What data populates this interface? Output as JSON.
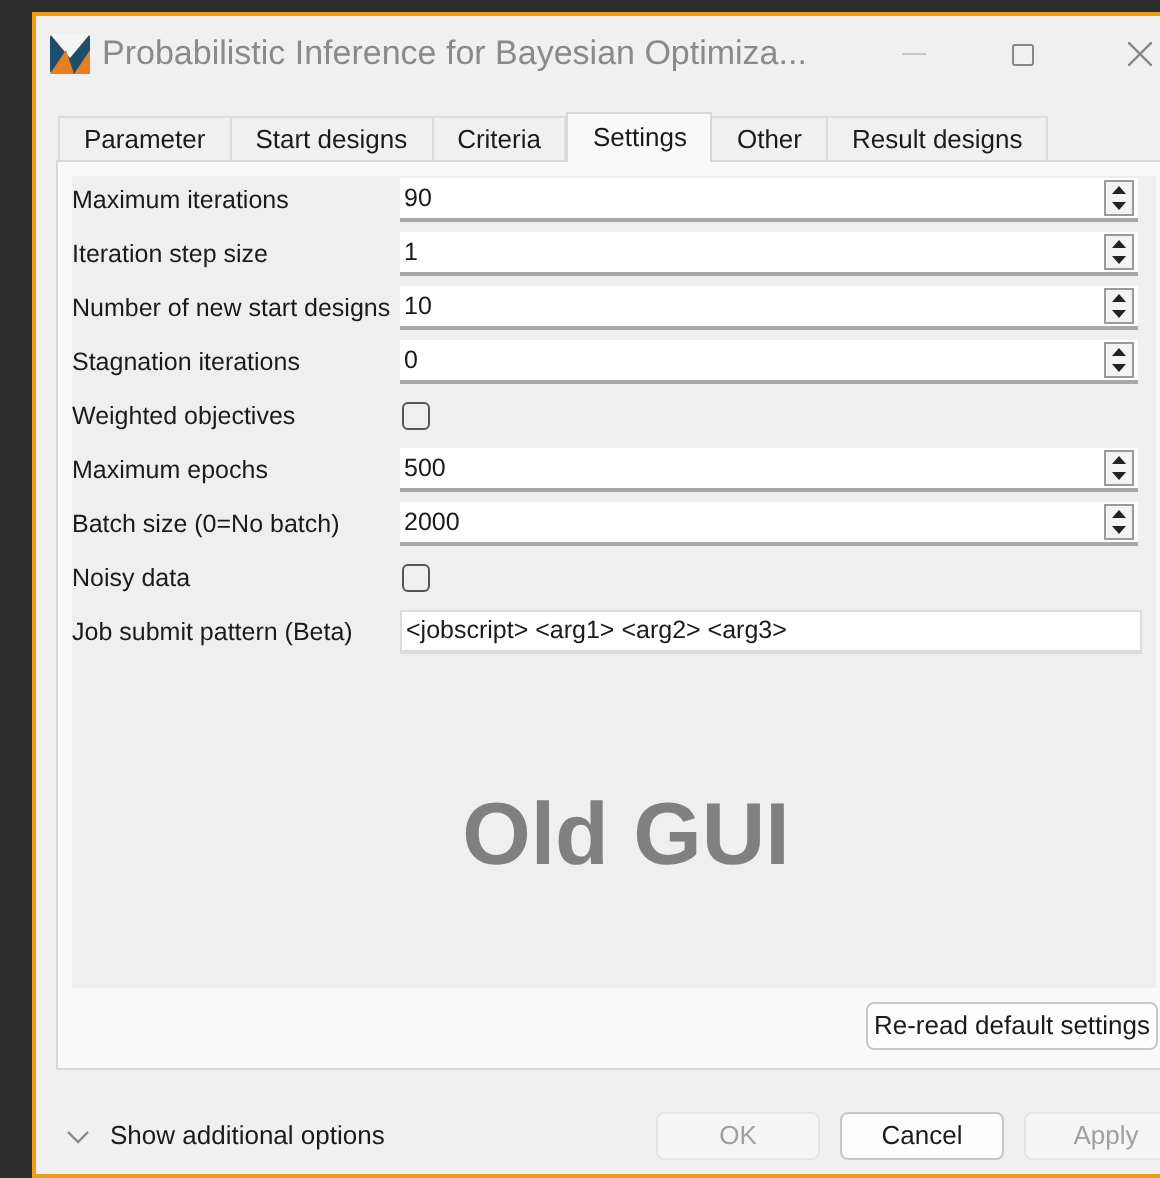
{
  "window": {
    "title": "Probabilistic Inference for Bayesian Optimiza..."
  },
  "tabs": [
    {
      "label": "Parameter",
      "selected": false
    },
    {
      "label": "Start designs",
      "selected": false
    },
    {
      "label": "Criteria",
      "selected": false
    },
    {
      "label": "Settings",
      "selected": true
    },
    {
      "label": "Other",
      "selected": false
    },
    {
      "label": "Result designs",
      "selected": false
    }
  ],
  "settings": [
    {
      "kind": "spin",
      "label": "Maximum iterations",
      "value": "90"
    },
    {
      "kind": "spin",
      "label": "Iteration step size",
      "value": "1"
    },
    {
      "kind": "spin",
      "label": "Number of new start designs",
      "value": "10"
    },
    {
      "kind": "spin",
      "label": "Stagnation iterations",
      "value": "0"
    },
    {
      "kind": "check",
      "label": "Weighted objectives",
      "checked": false
    },
    {
      "kind": "spin",
      "label": "Maximum epochs",
      "value": "500"
    },
    {
      "kind": "spin",
      "label": "Batch size (0=No batch)",
      "value": "2000"
    },
    {
      "kind": "check",
      "label": "Noisy data",
      "checked": false
    },
    {
      "kind": "text",
      "label": "Job submit pattern (Beta)",
      "value": "<jobscript> <arg1> <arg2> <arg3>"
    }
  ],
  "overlay_label": "Old GUI",
  "reread_button": "Re-read default settings",
  "expander": {
    "label": "Show additional options",
    "expanded": false
  },
  "buttons": [
    {
      "label": "OK",
      "disabled": true
    },
    {
      "label": "Cancel",
      "disabled": false
    },
    {
      "label": "Apply",
      "disabled": true
    }
  ]
}
